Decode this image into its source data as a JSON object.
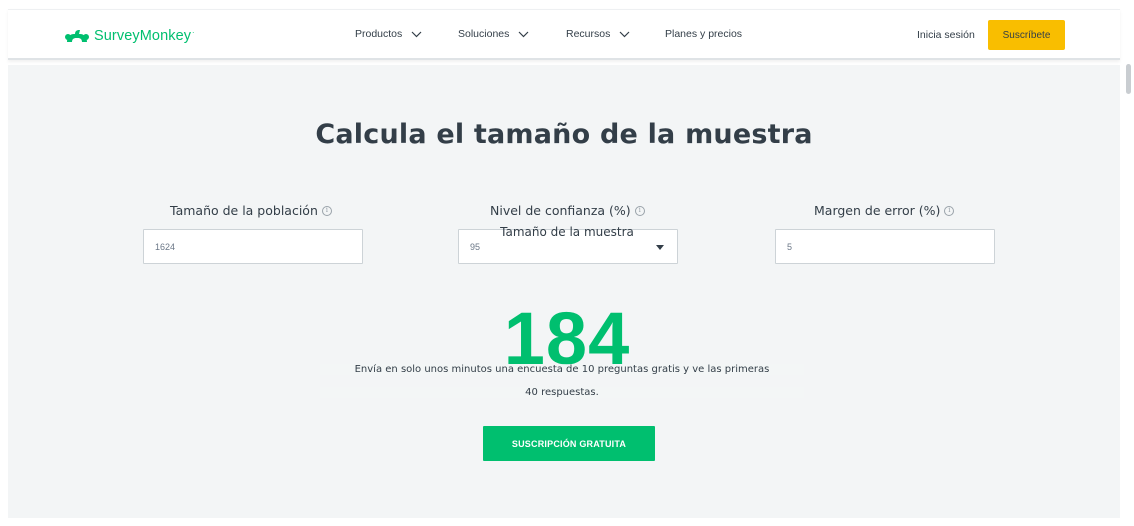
{
  "header": {
    "brand": "SurveyMonkey",
    "brand_mark": "·",
    "nav": [
      {
        "label": "Productos",
        "icon": "chevron-down-icon"
      },
      {
        "label": "Soluciones",
        "icon": "chevron-down-icon"
      },
      {
        "label": "Recursos",
        "icon": "chevron-down-icon"
      },
      {
        "label": "Planes y precios"
      }
    ],
    "login_label": "Inicia sesión",
    "subscribe_label": "Suscríbete"
  },
  "calculator": {
    "title": "Calcula el tamaño de la muestra",
    "info_glyph": "i",
    "fields": [
      {
        "label": "Tamaño de la población",
        "value": "1624",
        "type": "text"
      },
      {
        "label": "Nivel de confianza (%)",
        "value": "95",
        "type": "select"
      },
      {
        "label": "Margen de error (%)",
        "value": "5",
        "type": "text"
      }
    ],
    "result_label": "Tamaño de la muestra",
    "result_value": "184",
    "promo_line1": "Envía en solo unos minutos una encuesta de 10 preguntas gratis y ve las primeras",
    "promo_line2": "40 respuestas.",
    "cta_label": "SUSCRIPCIÓN GRATUITA"
  },
  "colors": {
    "brand_green": "#00bf6f",
    "subscribe_yellow": "#f9be00",
    "panel_bg": "#f3f5f6",
    "text_dark": "#333e48"
  }
}
